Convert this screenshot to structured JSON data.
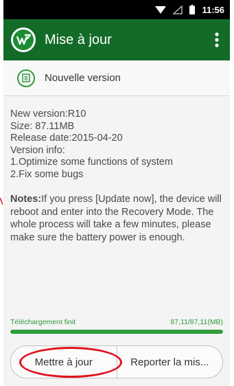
{
  "status_bar": {
    "time": "11:56",
    "icons": [
      "wifi-icon",
      "signal-icon",
      "battery-icon"
    ]
  },
  "app_bar": {
    "title": "Mise à jour",
    "logo_icon": "app-logo-icon",
    "menu_icon": "overflow-menu-icon"
  },
  "update_header": {
    "label": "Nouvelle version",
    "icon": "document-icon"
  },
  "details": {
    "lines": [
      "New version:R10",
      "Size: 87.11MB",
      "Release date:2015-04-20",
      "Version info:",
      "1.Optimize some functions of system",
      "2.Fix some bugs"
    ]
  },
  "notes": {
    "label": "Notes:",
    "text": "If you press [Update now], the device will reboot and enter into the Recovery Mode. The whole process will take a few minutes, please make sure the battery power is enough."
  },
  "download": {
    "status": "Téléchargement finit",
    "size": "87,11/87,11(MB)",
    "progress": 1.0
  },
  "buttons": {
    "update_now": "Mettre à jour",
    "postpone": "Reporter la mis..."
  },
  "colors": {
    "app_bar": "#136b28",
    "accent_green": "#2e9d3a",
    "annotation_red": "#e0121d"
  }
}
